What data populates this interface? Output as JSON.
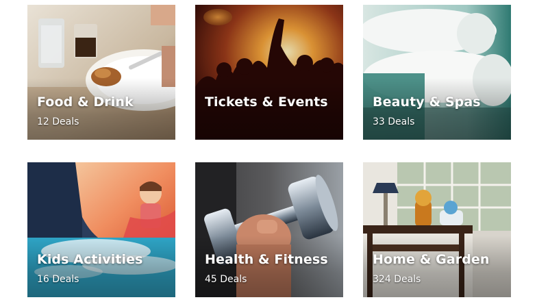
{
  "categories": [
    {
      "title": "Food & Drink",
      "deals": "12 Deals",
      "image": "food-drink-image"
    },
    {
      "title": "Tickets & Events",
      "deals": "",
      "image": "concert-image"
    },
    {
      "title": "Beauty & Spas",
      "deals": "33 Deals",
      "image": "towels-image"
    },
    {
      "title": "Kids Activities",
      "deals": "16 Deals",
      "image": "waterslide-image"
    },
    {
      "title": "Health & Fitness",
      "deals": "45 Deals",
      "image": "dumbbell-image"
    },
    {
      "title": "Home & Garden",
      "deals": "324 Deals",
      "image": "living-room-image"
    }
  ]
}
